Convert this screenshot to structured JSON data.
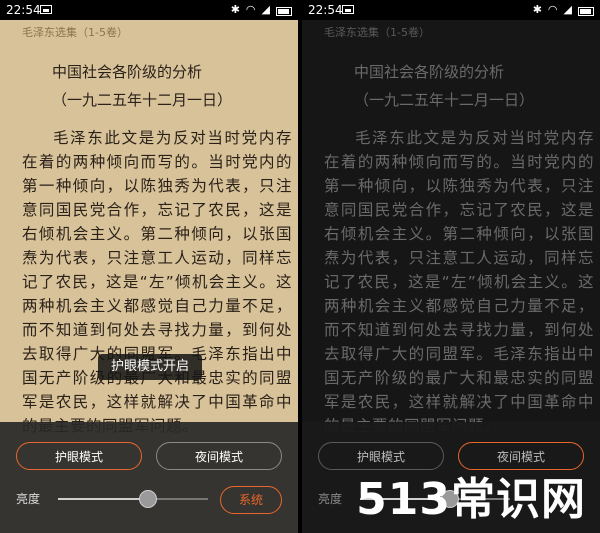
{
  "status_bar": {
    "time": "22:54"
  },
  "header": {
    "book_title": "毛泽东选集（1-5卷）"
  },
  "article": {
    "title": "中国社会各阶级的分析",
    "date": "（一九二五年十二月一日）",
    "body": "毛泽东此文是为反对当时党内存在着的两种倾向而写的。当时党内的第一种倾向，以陈独秀为代表，只注意同国民党合作，忘记了农民，这是右倾机会主义。第二种倾向，以张国焘为代表，只注意工人运动，同样忘记了农民，这是“左”倾机会主义。这两种机会主义都感觉自己力量不足，而不知道到何处去寻找力量，到何处去取得广大的同盟军。毛泽东指出中国无产阶级的最广大和最忠实的同盟军是农民，这样就解决了中国革命中的最主要的同盟军问题。"
  },
  "toast": {
    "text": "护眼模式开启"
  },
  "settings_panel": {
    "eye_mode_label": "护眼模式",
    "night_mode_label": "夜间模式",
    "brightness_label": "亮度",
    "system_label": "系统",
    "brightness_level": 0.6,
    "accent_color": "#e8672a"
  },
  "watermark": {
    "text": "513常识网"
  }
}
